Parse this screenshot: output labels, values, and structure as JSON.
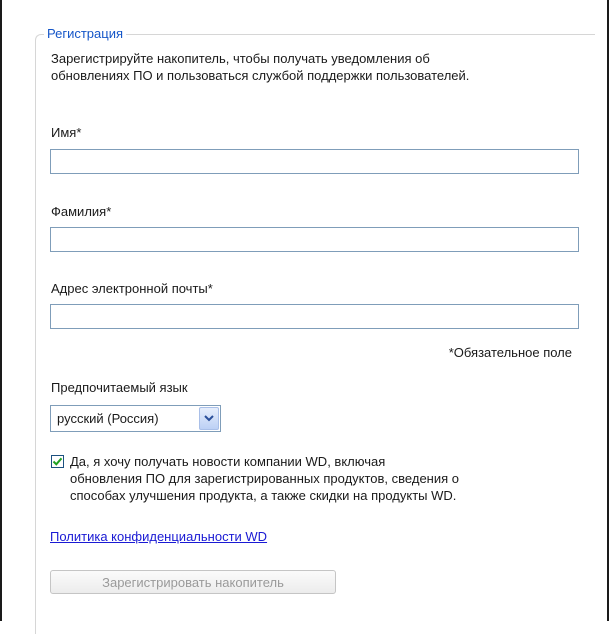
{
  "form": {
    "legend": "Регистрация",
    "intro_line1": "Зарегистрируйте накопитель, чтобы получать уведомления об",
    "intro_line2": "обновлениях ПО и пользоваться службой поддержки пользователей.",
    "first_name": {
      "label": "Имя*",
      "value": ""
    },
    "last_name": {
      "label": "Фамилия*",
      "value": ""
    },
    "email": {
      "label": "Адрес электронной почты*",
      "value": ""
    },
    "required_note": "*Обязательное поле",
    "language": {
      "label": "Предпочитаемый язык",
      "selected": "русский (Россия)"
    },
    "newsletter": {
      "checked": true,
      "line1": "Да, я хочу получать новости компании WD, включая",
      "line2": "обновления ПО для зарегистрированных продуктов, сведения о",
      "line3": "способах улучшения продукта, а также скидки на продукты WD."
    },
    "privacy_link": "Политика конфиденциальности WD",
    "submit_label": "Зарегистрировать накопитель",
    "submit_enabled": false
  },
  "colors": {
    "legend": "#1556c8",
    "link": "#1a1ad4",
    "input_border": "#7f9db9",
    "checkmark": "#21a121",
    "disabled_text": "#9a9a9a"
  },
  "icons": {
    "select_arrow": "chevron-down-icon",
    "checkbox_mark": "checkmark-icon"
  }
}
